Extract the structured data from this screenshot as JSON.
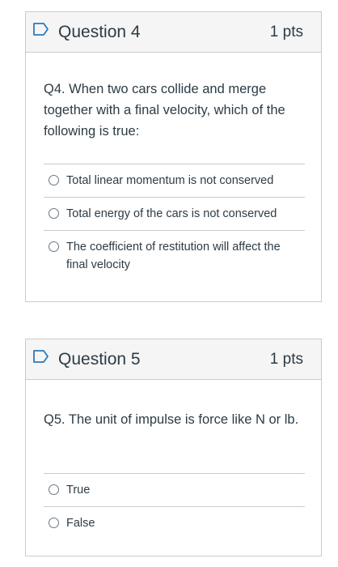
{
  "questions": [
    {
      "title": "Question 4",
      "points": "1 pts",
      "text": "Q4. When two cars collide and merge together with a final velocity, which of the following is true:",
      "answers": [
        "Total linear momentum is not conserved",
        "Total energy of the cars is not conserved",
        "The coefficient of restitution will affect the final velocity"
      ]
    },
    {
      "title": "Question 5",
      "points": "1 pts",
      "text": "Q5. The unit of impulse is force like N or lb.",
      "answers": [
        "True",
        "False"
      ]
    }
  ],
  "colors": {
    "border": "#c7cdd1",
    "header_bg": "#f5f5f5",
    "flag": "#2b7abc",
    "text": "#2d3b45"
  },
  "icons": {
    "flag": "flag-outline-icon",
    "radio": "radio-unchecked-icon"
  }
}
